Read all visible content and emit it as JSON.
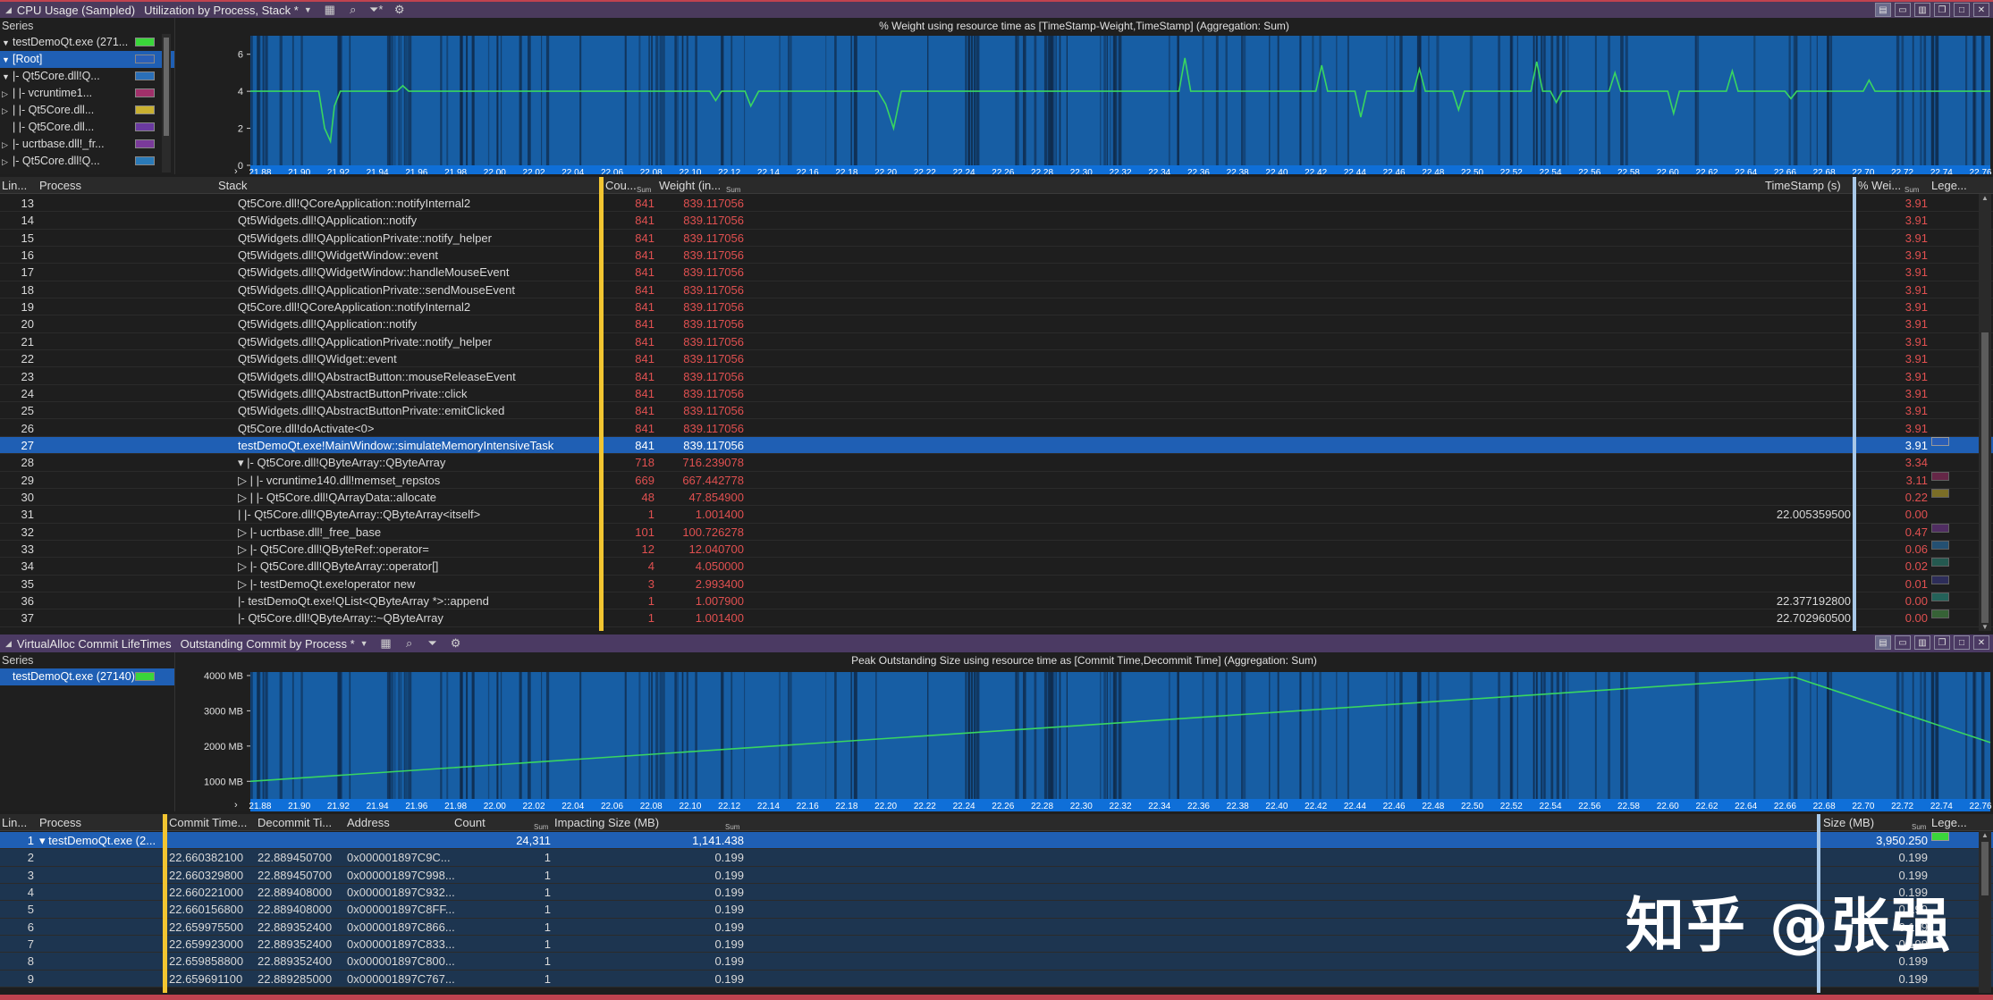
{
  "top_pane": {
    "title_items": [
      "CPU Usage (Sampled)",
      "Utilization by Process, Stack *"
    ],
    "series_label": "Series",
    "series": [
      {
        "label": "testDemoQt.exe (271...",
        "color": "#3ad63a",
        "sel": false,
        "arrow": "▼"
      },
      {
        "label": "[Root]",
        "color": "#2a5fb8",
        "sel": true,
        "arrow": "▼"
      },
      {
        "label": "|- Qt5Core.dll!Q...",
        "color": "#2a6fb8",
        "sel": false,
        "arrow": "▼"
      },
      {
        "label": "|   |- vcruntime1...",
        "color": "#a0306a",
        "sel": false,
        "arrow": "▷"
      },
      {
        "label": "|   |- Qt5Core.dll...",
        "color": "#c8b030",
        "sel": false,
        "arrow": "▷"
      },
      {
        "label": "|   |- Qt5Core.dll...",
        "color": "#6a3aa0",
        "sel": false,
        "arrow": ""
      },
      {
        "label": "|- ucrtbase.dll!_fr...",
        "color": "#7a3a9a",
        "sel": false,
        "arrow": "▷"
      },
      {
        "label": "|- Qt5Core.dll!Q...",
        "color": "#2a7ab8",
        "sel": false,
        "arrow": "▷"
      }
    ],
    "chart_title": "% Weight using resource time as [TimeStamp-Weight,TimeStamp] (Aggregation: Sum)",
    "columns": {
      "line": "Lin...",
      "process": "Process",
      "stack": "Stack",
      "count": "Cou...",
      "weight": "Weight (in...",
      "timestamp": "TimeStamp (s)",
      "pct": "% Wei...",
      "legend": "Lege...",
      "sum": "Sum"
    },
    "rows": [
      {
        "n": "13",
        "stack": "Qt5Core.dll!QCoreApplication::notifyInternal2",
        "count": "841",
        "weight": "839.117056",
        "ts": "",
        "pct": "3.91",
        "color": ""
      },
      {
        "n": "14",
        "stack": "Qt5Widgets.dll!QApplication::notify",
        "count": "841",
        "weight": "839.117056",
        "ts": "",
        "pct": "3.91",
        "color": ""
      },
      {
        "n": "15",
        "stack": "Qt5Widgets.dll!QApplicationPrivate::notify_helper",
        "count": "841",
        "weight": "839.117056",
        "ts": "",
        "pct": "3.91",
        "color": ""
      },
      {
        "n": "16",
        "stack": "Qt5Widgets.dll!QWidgetWindow::event",
        "count": "841",
        "weight": "839.117056",
        "ts": "",
        "pct": "3.91",
        "color": ""
      },
      {
        "n": "17",
        "stack": "Qt5Widgets.dll!QWidgetWindow::handleMouseEvent",
        "count": "841",
        "weight": "839.117056",
        "ts": "",
        "pct": "3.91",
        "color": ""
      },
      {
        "n": "18",
        "stack": "Qt5Widgets.dll!QApplicationPrivate::sendMouseEvent",
        "count": "841",
        "weight": "839.117056",
        "ts": "",
        "pct": "3.91",
        "color": ""
      },
      {
        "n": "19",
        "stack": "Qt5Core.dll!QCoreApplication::notifyInternal2",
        "count": "841",
        "weight": "839.117056",
        "ts": "",
        "pct": "3.91",
        "color": ""
      },
      {
        "n": "20",
        "stack": "Qt5Widgets.dll!QApplication::notify",
        "count": "841",
        "weight": "839.117056",
        "ts": "",
        "pct": "3.91",
        "color": ""
      },
      {
        "n": "21",
        "stack": "Qt5Widgets.dll!QApplicationPrivate::notify_helper",
        "count": "841",
        "weight": "839.117056",
        "ts": "",
        "pct": "3.91",
        "color": ""
      },
      {
        "n": "22",
        "stack": "Qt5Widgets.dll!QWidget::event",
        "count": "841",
        "weight": "839.117056",
        "ts": "",
        "pct": "3.91",
        "color": ""
      },
      {
        "n": "23",
        "stack": "Qt5Widgets.dll!QAbstractButton::mouseReleaseEvent",
        "count": "841",
        "weight": "839.117056",
        "ts": "",
        "pct": "3.91",
        "color": ""
      },
      {
        "n": "24",
        "stack": "Qt5Widgets.dll!QAbstractButtonPrivate::click",
        "count": "841",
        "weight": "839.117056",
        "ts": "",
        "pct": "3.91",
        "color": ""
      },
      {
        "n": "25",
        "stack": "Qt5Widgets.dll!QAbstractButtonPrivate::emitClicked",
        "count": "841",
        "weight": "839.117056",
        "ts": "",
        "pct": "3.91",
        "color": ""
      },
      {
        "n": "26",
        "stack": "Qt5Core.dll!doActivate<0>",
        "count": "841",
        "weight": "839.117056",
        "ts": "",
        "pct": "3.91",
        "color": ""
      },
      {
        "n": "27",
        "stack": "testDemoQt.exe!MainWindow::simulateMemoryIntensiveTask",
        "count": "841",
        "weight": "839.117056",
        "ts": "",
        "pct": "3.91",
        "color": "#2a5fb8",
        "sel": true
      },
      {
        "n": "28",
        "stack": "▾  |- Qt5Core.dll!QByteArray::QByteArray",
        "count": "718",
        "weight": "716.239078",
        "ts": "",
        "pct": "3.34",
        "color": ""
      },
      {
        "n": "29",
        "stack": "▷  |   |- vcruntime140.dll!memset_repstos",
        "count": "669",
        "weight": "667.442778",
        "ts": "",
        "pct": "3.11",
        "color": "#a0306a"
      },
      {
        "n": "30",
        "stack": "▷  |   |- Qt5Core.dll!QArrayData::allocate",
        "count": "48",
        "weight": "47.854900",
        "ts": "",
        "pct": "0.22",
        "color": "#c8b030"
      },
      {
        "n": "31",
        "stack": "    |   |- Qt5Core.dll!QByteArray::QByteArray<itself>",
        "count": "1",
        "weight": "1.001400",
        "ts": "22.005359500",
        "pct": "0.00",
        "color": ""
      },
      {
        "n": "32",
        "stack": "▷  |- ucrtbase.dll!_free_base",
        "count": "101",
        "weight": "100.726278",
        "ts": "",
        "pct": "0.47",
        "color": "#7a3a9a"
      },
      {
        "n": "33",
        "stack": "▷  |- Qt5Core.dll!QByteRef::operator=",
        "count": "12",
        "weight": "12.040700",
        "ts": "",
        "pct": "0.06",
        "color": "#2a7ab8"
      },
      {
        "n": "34",
        "stack": "▷  |- Qt5Core.dll!QByteArray::operator[]",
        "count": "4",
        "weight": "4.050000",
        "ts": "",
        "pct": "0.02",
        "color": "#2a8a7a"
      },
      {
        "n": "35",
        "stack": "▷  |- testDemoQt.exe!operator new",
        "count": "3",
        "weight": "2.993400",
        "ts": "",
        "pct": "0.01",
        "color": "#3a3a8a"
      },
      {
        "n": "36",
        "stack": "    |- testDemoQt.exe!QList<QByteArray *>::append",
        "count": "1",
        "weight": "1.007900",
        "ts": "22.377192800",
        "pct": "0.00",
        "color": "#2a9a8a"
      },
      {
        "n": "37",
        "stack": "    |- Qt5Core.dll!QByteArray::~QByteArray",
        "count": "1",
        "weight": "1.001400",
        "ts": "22.702960500",
        "pct": "0.00",
        "color": "#4a9a4a"
      }
    ]
  },
  "bottom_pane": {
    "title_items": [
      "VirtualAlloc Commit LifeTimes",
      "Outstanding Commit by Process *"
    ],
    "series_label": "Series",
    "series": [
      {
        "label": "testDemoQt.exe (27140)",
        "color": "#3ad63a",
        "sel": true
      }
    ],
    "chart_title": "Peak Outstanding Size using resource time as [Commit Time,Decommit Time] (Aggregation: Sum)",
    "columns": {
      "line": "Lin...",
      "process": "Process",
      "commit": "Commit Time...",
      "decommit": "Decommit Ti...",
      "address": "Address",
      "count": "Count",
      "impacting": "Impacting Size (MB)",
      "size": "Size (MB)",
      "legend": "Lege...",
      "sum": "Sum"
    },
    "rows": [
      {
        "n": "1",
        "process": "▾ testDemoQt.exe (2...",
        "commit": "",
        "decommit": "",
        "address": "",
        "count": "24,311",
        "impacting": "1,141.438",
        "size": "3,950.250",
        "sel": true
      },
      {
        "n": "2",
        "process": "",
        "commit": "22.660382100",
        "decommit": "22.889450700",
        "address": "0x000001897C9C...",
        "count": "1",
        "impacting": "0.199",
        "size": "0.199"
      },
      {
        "n": "3",
        "process": "",
        "commit": "22.660329800",
        "decommit": "22.889450700",
        "address": "0x000001897C998...",
        "count": "1",
        "impacting": "0.199",
        "size": "0.199"
      },
      {
        "n": "4",
        "process": "",
        "commit": "22.660221000",
        "decommit": "22.889408000",
        "address": "0x000001897C932...",
        "count": "1",
        "impacting": "0.199",
        "size": "0.199"
      },
      {
        "n": "5",
        "process": "",
        "commit": "22.660156800",
        "decommit": "22.889408000",
        "address": "0x000001897C8FF...",
        "count": "1",
        "impacting": "0.199",
        "size": "0.199"
      },
      {
        "n": "6",
        "process": "",
        "commit": "22.659975500",
        "decommit": "22.889352400",
        "address": "0x000001897C866...",
        "count": "1",
        "impacting": "0.199",
        "size": "0.199"
      },
      {
        "n": "7",
        "process": "",
        "commit": "22.659923000",
        "decommit": "22.889352400",
        "address": "0x000001897C833...",
        "count": "1",
        "impacting": "0.199",
        "size": "0.199"
      },
      {
        "n": "8",
        "process": "",
        "commit": "22.659858800",
        "decommit": "22.889352400",
        "address": "0x000001897C800...",
        "count": "1",
        "impacting": "0.199",
        "size": "0.199"
      },
      {
        "n": "9",
        "process": "",
        "commit": "22.659691100",
        "decommit": "22.889285000",
        "address": "0x000001897C767...",
        "count": "1",
        "impacting": "0.199",
        "size": "0.199"
      }
    ]
  },
  "chart_data": [
    {
      "type": "line",
      "title": "% Weight using resource time as [TimeStamp-Weight,TimeStamp] (Aggregation: Sum)",
      "xlabel": "",
      "ylabel": "",
      "x_ticks": [
        "21.88",
        "21.90",
        "21.92",
        "21.94",
        "21.96",
        "21.98",
        "22.00",
        "22.02",
        "22.04",
        "22.06",
        "22.08",
        "22.10",
        "22.12",
        "22.14",
        "22.16",
        "22.18",
        "22.20",
        "22.22",
        "22.24",
        "22.26",
        "22.28",
        "22.30",
        "22.32",
        "22.34",
        "22.36",
        "22.38",
        "22.40",
        "22.42",
        "22.44",
        "22.46",
        "22.48",
        "22.50",
        "22.52",
        "22.54",
        "22.56",
        "22.58",
        "22.60",
        "22.62",
        "22.64",
        "22.66",
        "22.68",
        "22.70",
        "22.72",
        "22.74",
        "22.76"
      ],
      "y_ticks": [
        "0",
        "2",
        "4",
        "6"
      ],
      "ylim": [
        0,
        7
      ],
      "xlim": [
        21.875,
        22.765
      ],
      "baseline": 4.0,
      "series": [
        {
          "color": "#39d660",
          "x": [
            21.875,
            21.91,
            21.913,
            21.916,
            21.918,
            21.921,
            21.95,
            21.953,
            21.956,
            21.99,
            22.08,
            22.11,
            22.113,
            22.116,
            22.128,
            22.131,
            22.135,
            22.196,
            22.2,
            22.204,
            22.208,
            22.26,
            22.35,
            22.353,
            22.356,
            22.42,
            22.423,
            22.426,
            22.44,
            22.443,
            22.446,
            22.47,
            22.473,
            22.476,
            22.49,
            22.493,
            22.496,
            22.53,
            22.533,
            22.536,
            22.54,
            22.543,
            22.546,
            22.57,
            22.573,
            22.576,
            22.6,
            22.603,
            22.606,
            22.63,
            22.633,
            22.636,
            22.66,
            22.663,
            22.666,
            22.7,
            22.703,
            22.706,
            22.765
          ],
          "y": [
            4.0,
            4.0,
            2.0,
            1.3,
            3.2,
            4.0,
            4.0,
            4.3,
            4.0,
            4.0,
            4.0,
            4.0,
            3.5,
            4.0,
            4.0,
            3.2,
            4.0,
            4.0,
            3.3,
            2.0,
            4.0,
            4.0,
            4.0,
            5.8,
            4.0,
            4.0,
            5.4,
            4.0,
            4.0,
            2.6,
            4.0,
            4.0,
            5.2,
            4.0,
            4.0,
            3.0,
            4.0,
            4.0,
            5.6,
            4.0,
            4.0,
            3.4,
            4.0,
            4.0,
            5.0,
            4.0,
            4.0,
            2.8,
            4.0,
            4.0,
            5.1,
            4.0,
            4.0,
            3.6,
            4.0,
            4.0,
            4.6,
            4.0,
            4.0
          ]
        }
      ]
    },
    {
      "type": "line",
      "title": "Peak Outstanding Size using resource time as [Commit Time,Decommit Time] (Aggregation: Sum)",
      "xlabel": "",
      "ylabel": "",
      "x_ticks": [
        "21.88",
        "21.90",
        "21.92",
        "21.94",
        "21.96",
        "21.98",
        "22.00",
        "22.02",
        "22.04",
        "22.06",
        "22.08",
        "22.10",
        "22.12",
        "22.14",
        "22.16",
        "22.18",
        "22.20",
        "22.22",
        "22.24",
        "22.26",
        "22.28",
        "22.30",
        "22.32",
        "22.34",
        "22.36",
        "22.38",
        "22.40",
        "22.42",
        "22.44",
        "22.46",
        "22.48",
        "22.50",
        "22.52",
        "22.54",
        "22.56",
        "22.58",
        "22.60",
        "22.62",
        "22.64",
        "22.66",
        "22.68",
        "22.70",
        "22.72",
        "22.74",
        "22.76"
      ],
      "y_ticks": [
        "1000 MB",
        "2000 MB",
        "3000 MB",
        "4000 MB"
      ],
      "ylim": [
        500,
        4100
      ],
      "xlim": [
        21.875,
        22.765
      ],
      "series": [
        {
          "color": "#39d660",
          "x": [
            21.875,
            22.665,
            22.765
          ],
          "y": [
            1000,
            3950,
            2100
          ]
        }
      ]
    }
  ],
  "watermark": "知乎 @张强",
  "colors": {
    "chart_bg": "#175ea4",
    "chart_stripe": "#0f2a4a",
    "plot_line": "#39d660",
    "selection": "#1f5fb4",
    "yellow_divider": "#f2c531"
  }
}
